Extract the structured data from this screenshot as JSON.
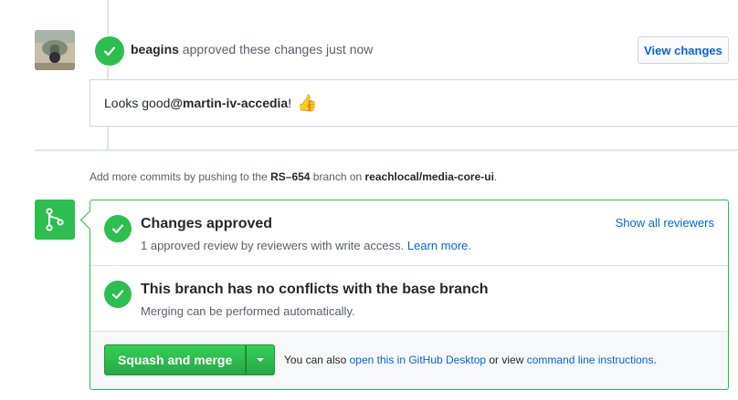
{
  "review": {
    "author": "beagins",
    "action": "approved these changes just now",
    "view_changes_label": "View changes",
    "comment_prefix": "Looks good ",
    "comment_mention": "@martin-iv-accedia",
    "comment_suffix": " !",
    "comment_emoji": "👍"
  },
  "push_info": {
    "prefix": "Add more commits by pushing to the ",
    "branch": "RS–654",
    "middle": " branch on ",
    "repo": "reachlocal/media-core-ui",
    "suffix": "."
  },
  "merge": {
    "approved_title": "Changes approved",
    "approved_desc": "1 approved review by reviewers with write access.",
    "learn_more": "Learn more.",
    "show_reviewers": "Show all reviewers",
    "conflicts_title": "This branch has no conflicts with the base branch",
    "conflicts_desc": "Merging can be performed automatically.",
    "merge_button": "Squash and merge",
    "alt_prefix": "You can also ",
    "alt_desktop_link": "open this in GitHub Desktop",
    "alt_middle": " or view ",
    "alt_cli_link": "command line instructions",
    "alt_suffix": "."
  },
  "colors": {
    "success_green": "#2cbe4e",
    "link_blue": "#0366d6",
    "muted_text": "#586069",
    "border": "#d1d5da"
  },
  "icons": {
    "review_status": "check-icon",
    "merge_status": "git-merge-icon",
    "dropdown": "triangle-down-icon"
  }
}
